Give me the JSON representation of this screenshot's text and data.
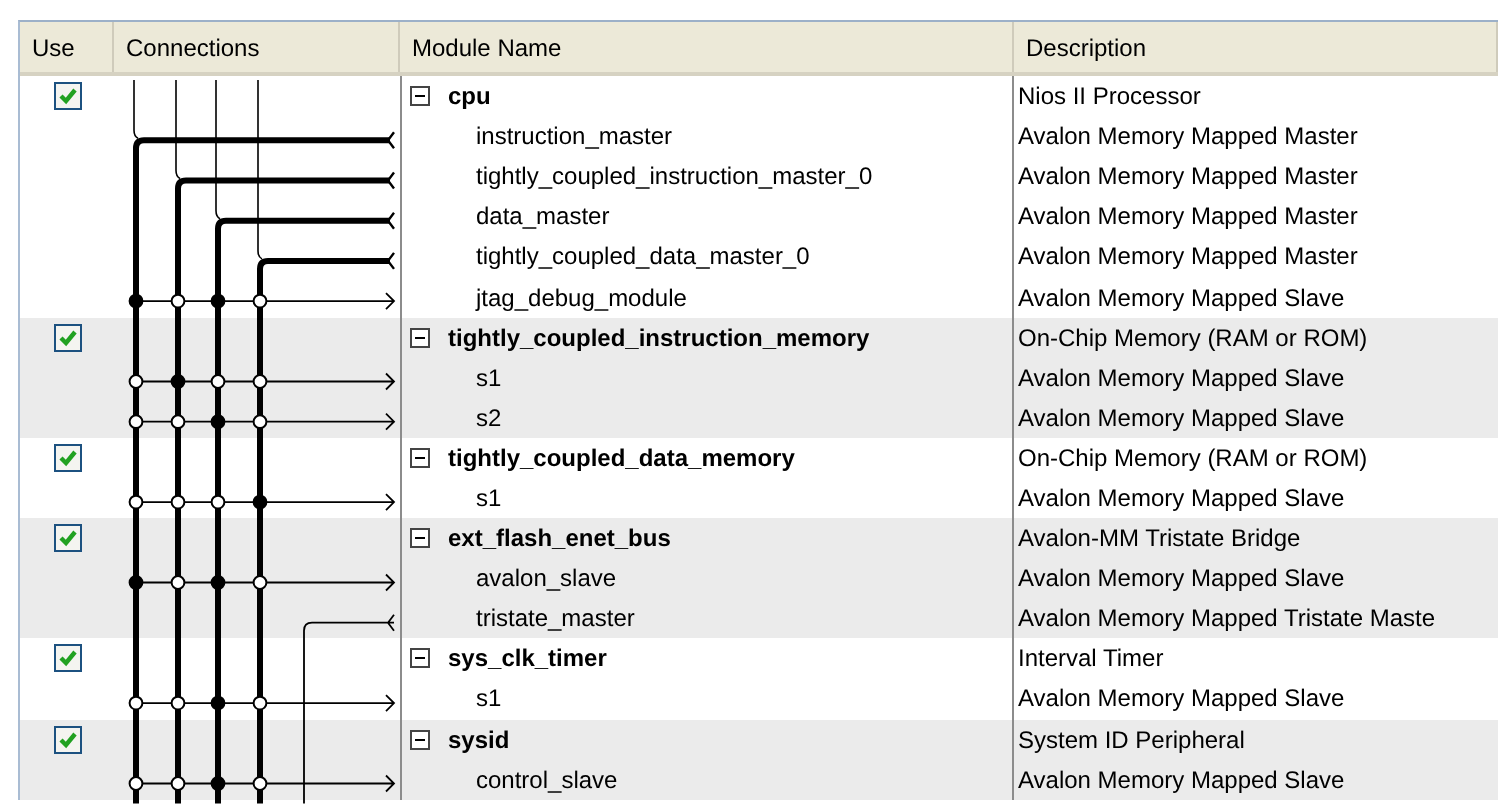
{
  "columns": [
    "Use",
    "Connections",
    "Module Name",
    "Description"
  ],
  "modules": [
    {
      "name": "cpu",
      "description": "Nios II Processor",
      "use": true,
      "expanded": true,
      "ports": [
        {
          "name": "instruction_master",
          "description": "Avalon Memory Mapped Master",
          "kind": "master"
        },
        {
          "name": "tightly_coupled_instruction_master_0",
          "description": "Avalon Memory Mapped Master",
          "kind": "master"
        },
        {
          "name": "data_master",
          "description": "Avalon Memory Mapped Master",
          "kind": "master"
        },
        {
          "name": "tightly_coupled_data_master_0",
          "description": "Avalon Memory Mapped Master",
          "kind": "master"
        },
        {
          "name": "jtag_debug_module",
          "description": "Avalon Memory Mapped Slave",
          "kind": "slave",
          "links": [
            true,
            false,
            true,
            false
          ]
        }
      ]
    },
    {
      "name": "tightly_coupled_instruction_memory",
      "description": "On-Chip Memory (RAM or ROM)",
      "use": true,
      "expanded": true,
      "ports": [
        {
          "name": "s1",
          "description": "Avalon Memory Mapped Slave",
          "kind": "slave",
          "links": [
            false,
            true,
            false,
            false
          ]
        },
        {
          "name": "s2",
          "description": "Avalon Memory Mapped Slave",
          "kind": "slave",
          "links": [
            false,
            false,
            true,
            false
          ]
        }
      ]
    },
    {
      "name": "tightly_coupled_data_memory",
      "description": "On-Chip Memory (RAM or ROM)",
      "use": true,
      "expanded": true,
      "ports": [
        {
          "name": "s1",
          "description": "Avalon Memory Mapped Slave",
          "kind": "slave",
          "links": [
            false,
            false,
            false,
            true
          ]
        }
      ]
    },
    {
      "name": "ext_flash_enet_bus",
      "description": "Avalon-MM Tristate Bridge",
      "use": true,
      "expanded": true,
      "ports": [
        {
          "name": "avalon_slave",
          "description": "Avalon Memory Mapped Slave",
          "kind": "slave",
          "links": [
            true,
            false,
            true,
            false
          ]
        },
        {
          "name": "tristate_master",
          "description": "Avalon Memory Mapped Tristate Maste",
          "kind": "tristate_master"
        }
      ]
    },
    {
      "name": "sys_clk_timer",
      "description": "Interval Timer",
      "use": true,
      "expanded": true,
      "ports": [
        {
          "name": "s1",
          "description": "Avalon Memory Mapped Slave",
          "kind": "slave",
          "links": [
            false,
            false,
            true,
            false
          ]
        }
      ]
    },
    {
      "name": "sysid",
      "description": "System ID Peripheral",
      "use": true,
      "expanded": true,
      "ports": [
        {
          "name": "control_slave",
          "description": "Avalon Memory Mapped Slave",
          "kind": "slave",
          "links": [
            false,
            false,
            true,
            false
          ]
        }
      ]
    }
  ]
}
